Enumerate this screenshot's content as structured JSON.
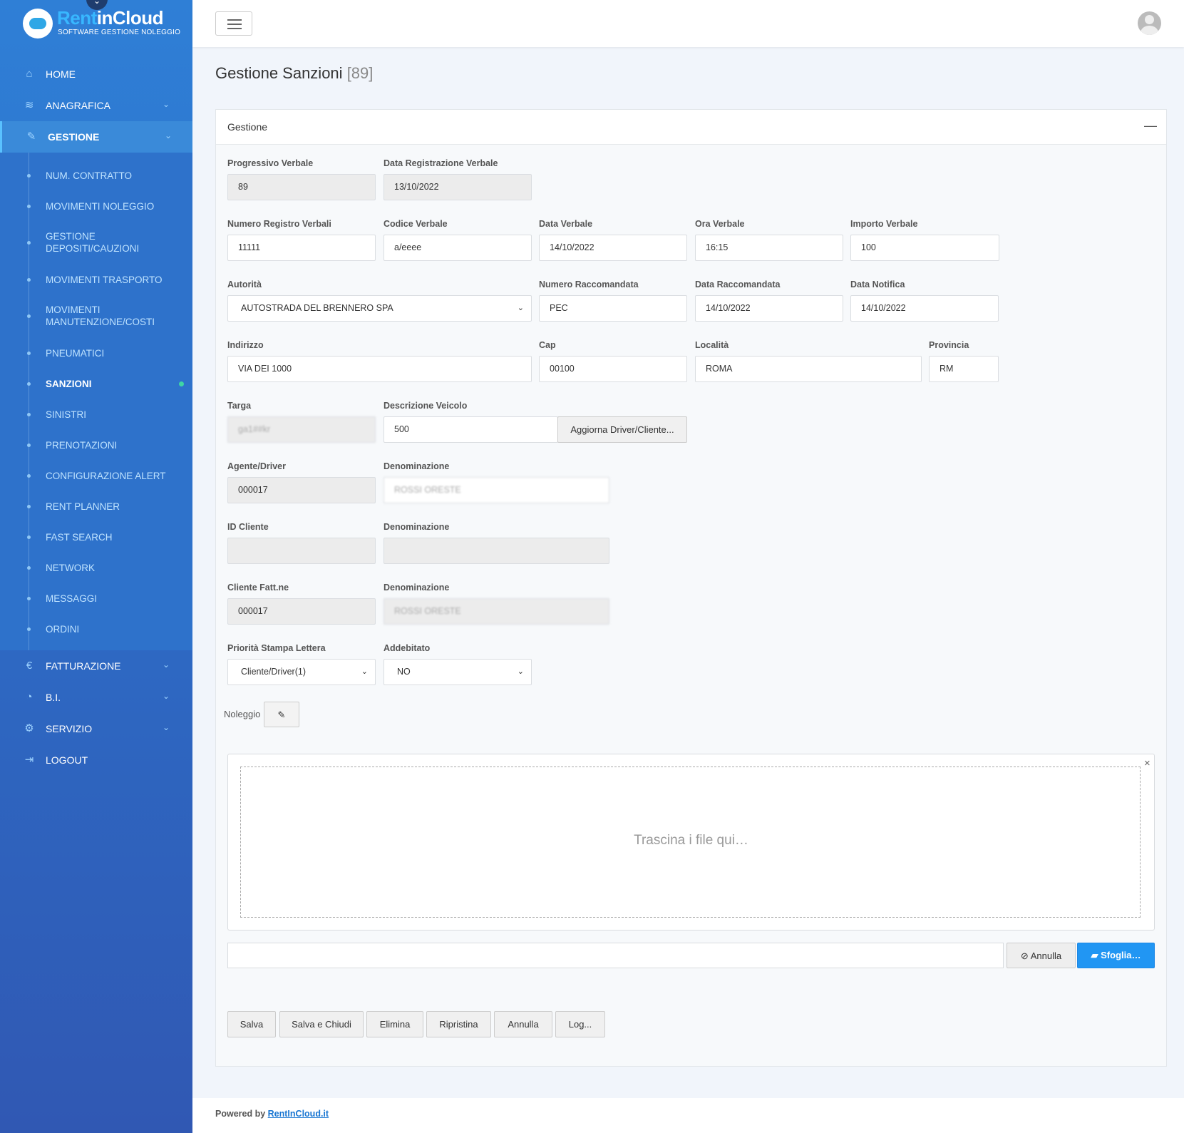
{
  "brand": {
    "name_part1": "Rent",
    "name_part2": "inCloud",
    "tagline": "SOFTWARE GESTIONE NOLEGGIO"
  },
  "nav": {
    "home": "HOME",
    "anagrafica": "ANAGRAFICA",
    "gestione": "GESTIONE",
    "fatturazione": "FATTURAZIONE",
    "bi": "B.I.",
    "servizio": "SERVIZIO",
    "logout": "LOGOUT"
  },
  "submenu": [
    "NUM. CONTRATTO",
    "MOVIMENTI NOLEGGIO",
    "GESTIONE DEPOSITI/CAUZIONI",
    "MOVIMENTI TRASPORTO",
    "MOVIMENTI MANUTENZIONE/COSTI",
    "PNEUMATICI",
    "SANZIONI",
    "SINISTRI",
    "PRENOTAZIONI",
    "CONFIGURAZIONE ALERT",
    "RENT PLANNER",
    "FAST SEARCH",
    "NETWORK",
    "MESSAGGI",
    "ORDINI"
  ],
  "page": {
    "title": "Gestione Sanzioni",
    "count": "[89]"
  },
  "panel": {
    "title": "Gestione",
    "collapse": "—"
  },
  "form": {
    "progressivo_verbale": {
      "label": "Progressivo Verbale",
      "value": "89"
    },
    "data_registrazione": {
      "label": "Data Registrazione Verbale",
      "value": "13/10/2022"
    },
    "numero_registro": {
      "label": "Numero Registro Verbali",
      "value": "11111"
    },
    "codice_verbale": {
      "label": "Codice Verbale",
      "value": "a/eeee"
    },
    "data_verbale": {
      "label": "Data Verbale",
      "value": "14/10/2022"
    },
    "ora_verbale": {
      "label": "Ora Verbale",
      "value": "16:15"
    },
    "importo_verbale": {
      "label": "Importo Verbale",
      "value": "100"
    },
    "autorita": {
      "label": "Autorità",
      "value": "AUTOSTRADA DEL BRENNERO SPA"
    },
    "numero_raccomandata": {
      "label": "Numero Raccomandata",
      "value": "PEC"
    },
    "data_raccomandata": {
      "label": "Data Raccomandata",
      "value": "14/10/2022"
    },
    "data_notifica": {
      "label": "Data Notifica",
      "value": "14/10/2022"
    },
    "indirizzo": {
      "label": "Indirizzo",
      "value": "VIA DEI 1000"
    },
    "cap": {
      "label": "Cap",
      "value": "00100"
    },
    "localita": {
      "label": "Località",
      "value": "ROMA"
    },
    "provincia": {
      "label": "Provincia",
      "value": "RM"
    },
    "targa": {
      "label": "Targa",
      "value": "ga1##kr"
    },
    "descrizione_veicolo": {
      "label": "Descrizione Veicolo",
      "value": "500"
    },
    "aggiorna_btn": "Aggiorna Driver/Cliente...",
    "agente_driver": {
      "label": "Agente/Driver",
      "value": "000017"
    },
    "denominazione_driver": {
      "label": "Denominazione",
      "value": "ROSSI ORESTE"
    },
    "id_cliente": {
      "label": "ID Cliente",
      "value": ""
    },
    "denominazione_cliente": {
      "label": "Denominazione",
      "value": ""
    },
    "cliente_fatt": {
      "label": "Cliente Fatt.ne",
      "value": "000017"
    },
    "denominazione_fatt": {
      "label": "Denominazione",
      "value": "ROSSI ORESTE"
    },
    "priorita_stampa": {
      "label": "Priorità Stampa Lettera",
      "value": "Cliente/Driver(1)"
    },
    "addebitato": {
      "label": "Addebitato",
      "value": "NO"
    },
    "noleggio_label": "Noleggio"
  },
  "upload": {
    "dropzone_text": "Trascina i file qui…",
    "close": "×",
    "cancel_label": "Annulla",
    "browse_label": "Sfoglia…"
  },
  "actions": {
    "salva": "Salva",
    "salva_chiudi": "Salva e Chiudi",
    "elimina": "Elimina",
    "ripristina": "Ripristina",
    "annulla": "Annulla",
    "log": "Log..."
  },
  "footer": {
    "prefix": "Powered by",
    "link": "RentInCloud.it"
  },
  "colors": {
    "sidebar": "#2f7fd6",
    "primary": "#2196f3",
    "active_dot": "#3fd6a4"
  }
}
